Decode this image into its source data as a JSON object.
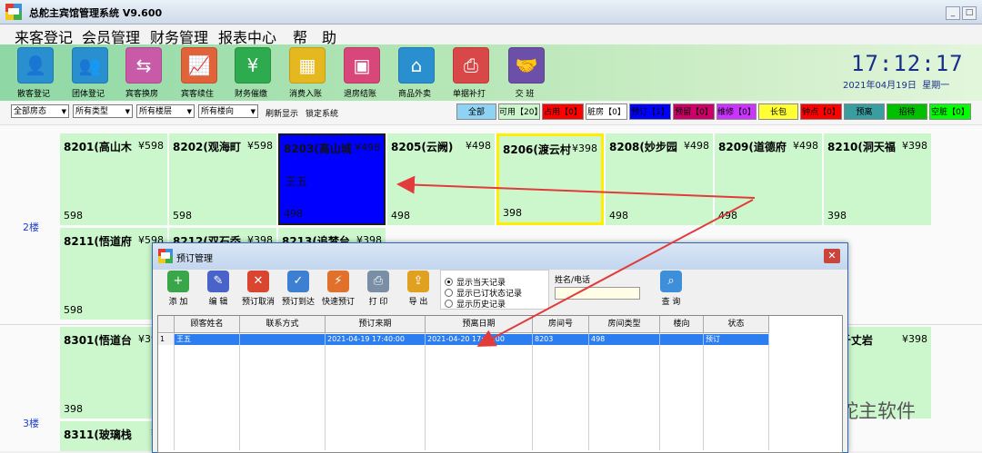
{
  "window": {
    "title": "总舵主宾馆管理系统 V9.600"
  },
  "menu": [
    "来客登记",
    "会员管理",
    "财务管理",
    "报表中心",
    "帮",
    "助"
  ],
  "toolbar": [
    {
      "label": "散客登记",
      "icon": "person-icon",
      "color": "#2a8fcf",
      "glyph": "👤"
    },
    {
      "label": "团体登记",
      "icon": "group-icon",
      "color": "#2a8fcf",
      "glyph": "👥"
    },
    {
      "label": "宾客换房",
      "icon": "door-exchange-icon",
      "color": "#c85aa8",
      "glyph": "⇆"
    },
    {
      "label": "宾客续住",
      "icon": "trend-chart-icon",
      "color": "#e0633a",
      "glyph": "📈"
    },
    {
      "label": "财务催缴",
      "icon": "money-hand-icon",
      "color": "#2eaa4f",
      "glyph": "¥"
    },
    {
      "label": "消费入账",
      "icon": "cash-register-icon",
      "color": "#e6b820",
      "glyph": "▦"
    },
    {
      "label": "退房结账",
      "icon": "wallet-icon",
      "color": "#d8477a",
      "glyph": "▣"
    },
    {
      "label": "商品外卖",
      "icon": "shop-icon",
      "color": "#2a8fcf",
      "glyph": "⌂"
    },
    {
      "label": "单据补打",
      "icon": "printer-icon",
      "color": "#d94848",
      "glyph": "⎙"
    },
    {
      "label": "交  班",
      "icon": "handshake-icon",
      "color": "#6b4fa8",
      "glyph": "🤝"
    }
  ],
  "clock": {
    "time": "17:12:17",
    "date": "2021年04月19日",
    "weekday": "星期一"
  },
  "filters": {
    "selects": [
      "全部房态",
      "所有类型",
      "所有楼层",
      "所有楼向"
    ],
    "refresh_label": "刷新显示",
    "lock_label": "锁定系统",
    "statuses": [
      {
        "label": "全部",
        "color": "#8fd3f4"
      },
      {
        "label": "可用【20】",
        "color": "#ccf7cc"
      },
      {
        "label": "占用【0】",
        "color": "#ff0000"
      },
      {
        "label": "脏房【0】",
        "color": "#ffffff"
      },
      {
        "label": "预订【1】",
        "color": "#0000ff"
      },
      {
        "label": "预留【0】",
        "color": "#cc0066"
      },
      {
        "label": "维修【0】",
        "color": "#cc33ff"
      },
      {
        "label": "长包",
        "color": "#ffff33"
      },
      {
        "label": "钟点【0】",
        "color": "#ff0000"
      },
      {
        "label": "预离",
        "color": "#3a9ea0"
      },
      {
        "label": "招待",
        "color": "#00c000"
      },
      {
        "label": "空脏【0】",
        "color": "#00ff00"
      }
    ]
  },
  "floors": [
    {
      "label": "2楼"
    },
    {
      "label": "3楼"
    }
  ],
  "rooms_row1": [
    {
      "name": "8201(高山木",
      "price": "¥598",
      "base": "598"
    },
    {
      "name": "8202(观海町",
      "price": "¥598",
      "base": "598"
    },
    {
      "name": "8203(高山城",
      "price": "¥498",
      "base": "498",
      "guest": "王五",
      "state": "booked"
    },
    {
      "name": "8205(云阙)",
      "price": "¥498",
      "base": "498"
    },
    {
      "name": "8206(渡云村",
      "price": "¥398",
      "base": "398",
      "state": "selected"
    },
    {
      "name": "8208(妙步园",
      "price": "¥498",
      "base": "498"
    },
    {
      "name": "8209(道德府",
      "price": "¥498",
      "base": "498"
    },
    {
      "name": "8210(洞天福",
      "price": "¥398",
      "base": "398"
    }
  ],
  "rooms_row2": [
    {
      "name": "8211(悟道府",
      "price": "¥598",
      "base": "598"
    },
    {
      "name": "8212(双石岙",
      "price": "¥398",
      "base": ""
    },
    {
      "name": "8213(追梦台",
      "price": "¥398",
      "base": ""
    }
  ],
  "rooms_row3": [
    {
      "name": "8301(悟道台",
      "price": "¥398",
      "base": "398"
    },
    {
      "name": "0(千丈岩",
      "price": "¥398",
      "base": ""
    }
  ],
  "rooms_row4": [
    {
      "name": "8311(玻璃栈",
      "price": "¥3",
      "base": ""
    }
  ],
  "watermark": "总舵主软件",
  "dialog": {
    "title": "预订管理",
    "toolbar": [
      {
        "label": "添 加",
        "icon": "add-icon",
        "color": "#3aa64a",
        "glyph": "+"
      },
      {
        "label": "编 辑",
        "icon": "edit-icon",
        "color": "#4a63c9",
        "glyph": "✎"
      },
      {
        "label": "预订取消",
        "icon": "cancel-icon",
        "color": "#d9452f",
        "glyph": "✕"
      },
      {
        "label": "预订到达",
        "icon": "arrive-icon",
        "color": "#3d7fd0",
        "glyph": "✓"
      },
      {
        "label": "快速预订",
        "icon": "quick-book-icon",
        "color": "#e0702a",
        "glyph": "⚡"
      },
      {
        "label": "打 印",
        "icon": "printer-icon",
        "color": "#7a8ea6",
        "glyph": "⎙"
      },
      {
        "label": "导 出",
        "icon": "export-icon",
        "color": "#e0a020",
        "glyph": "⇪"
      }
    ],
    "radios": [
      {
        "label": "显示当天记录",
        "checked": true
      },
      {
        "label": "显示已订状态记录",
        "checked": false
      },
      {
        "label": "显示历史记录",
        "checked": false
      }
    ],
    "search_label": "姓名/电话",
    "search_value": "",
    "query_label": "查 询",
    "columns": [
      "顾客姓名",
      "联系方式",
      "预订来期",
      "预离日期",
      "房间号",
      "房间类型",
      "楼向",
      "状态"
    ],
    "rows": [
      {
        "index": "1",
        "name": "王五",
        "contact": "",
        "arrive": "2021-04-19 17:40:00",
        "depart": "2021-04-20 17:10:00",
        "room": "8203",
        "type": "498",
        "facing": "",
        "status": "预订"
      }
    ]
  }
}
